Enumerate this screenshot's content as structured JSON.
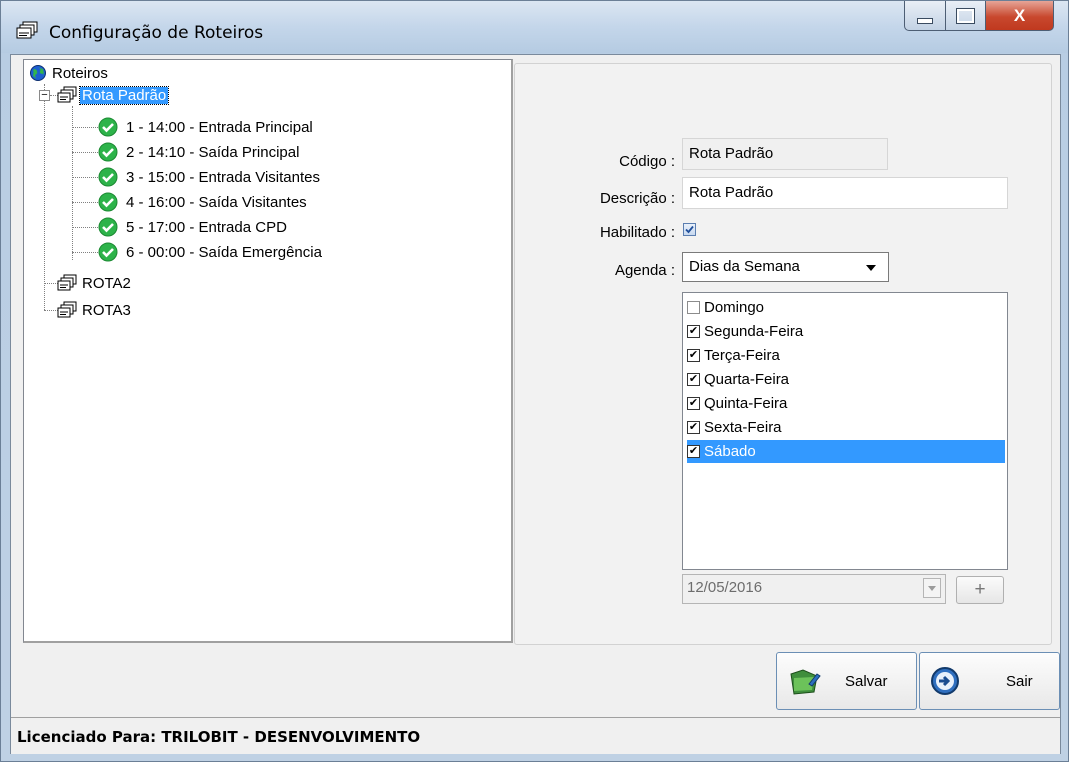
{
  "window": {
    "title": "Configuração de Roteiros",
    "close_label": "X"
  },
  "tree": {
    "root_label": "Roteiros",
    "routes": [
      {
        "label": "Rota Padrão",
        "expanded": true,
        "selected": true,
        "children": [
          "1 - 14:00 - Entrada Principal",
          "2 - 14:10 - Saída Principal",
          "3 - 15:00 - Entrada Visitantes",
          "4 - 16:00 - Saída Visitantes",
          "5 - 17:00 - Entrada CPD",
          "6 - 00:00 - Saída Emergência"
        ]
      },
      {
        "label": "ROTA2"
      },
      {
        "label": "ROTA3"
      }
    ]
  },
  "form": {
    "codigo_label": "Código :",
    "codigo_value": "Rota Padrão",
    "descricao_label": "Descrição :",
    "descricao_value": "Rota Padrão",
    "habilitado_label": "Habilitado :",
    "habilitado_checked": true,
    "agenda_label": "Agenda :",
    "agenda_value": "Dias da Semana",
    "days": [
      {
        "label": "Domingo",
        "checked": false
      },
      {
        "label": "Segunda-Feira",
        "checked": true
      },
      {
        "label": "Terça-Feira",
        "checked": true
      },
      {
        "label": "Quarta-Feira",
        "checked": true
      },
      {
        "label": "Quinta-Feira",
        "checked": true
      },
      {
        "label": "Sexta-Feira",
        "checked": true
      },
      {
        "label": "Sábado",
        "checked": true,
        "selected": true
      }
    ],
    "date_value": "12/05/2016",
    "plus_label": "+"
  },
  "buttons": {
    "save_label": "Salvar",
    "exit_label": "Sair"
  },
  "status": {
    "license_text": "Licenciado Para: TRILOBIT - DESENVOLVIMENTO"
  },
  "colors": {
    "selection": "#3399ff",
    "check_ok": "#2db34a"
  }
}
